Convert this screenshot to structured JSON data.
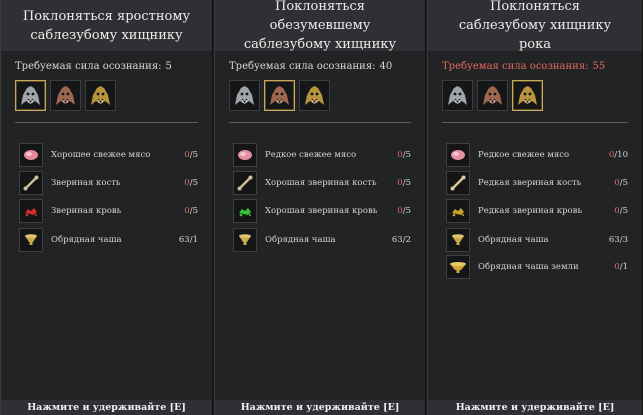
{
  "panels": [
    {
      "title": "Поклоняться яростному саблезубому хищнику",
      "requirement_label": "Требуемая сила осознания:",
      "requirement_value": "5",
      "requirement_warning": false,
      "selected_beast": 0,
      "beasts": [
        "silver-beast-icon",
        "bronze-beast-icon",
        "gold-beast-icon"
      ],
      "materials": [
        {
          "name": "Хорошее свежее мясо",
          "have": "0",
          "need": "5",
          "icon": "meat-icon",
          "color": "#e28b9b",
          "low": true
        },
        {
          "name": "Звериная кость",
          "have": "0",
          "need": "5",
          "icon": "bone-icon",
          "color": "#cdbf99",
          "low": true
        },
        {
          "name": "Звериная кровь",
          "have": "0",
          "need": "5",
          "icon": "blood-icon",
          "color": "#d02e2e",
          "low": true
        },
        {
          "name": "Обрядная чаша",
          "have": "63",
          "need": "1",
          "icon": "chalice-icon",
          "color": "#c9a94e",
          "low": false
        }
      ],
      "footer": "Нажмите и удерживайте [E]"
    },
    {
      "title": "Поклоняться обезумевшему саблезубому хищнику",
      "requirement_label": "Требуемая сила осознания:",
      "requirement_value": "40",
      "requirement_warning": false,
      "selected_beast": 1,
      "beasts": [
        "silver-beast-icon",
        "bronze-beast-icon",
        "gold-beast-icon"
      ],
      "materials": [
        {
          "name": "Редкое свежее мясо",
          "have": "0",
          "need": "5",
          "icon": "meat-icon",
          "color": "#e58fa0",
          "low": true
        },
        {
          "name": "Хорошая звериная кость",
          "have": "0",
          "need": "5",
          "icon": "bone-icon",
          "color": "#cdbf99",
          "low": true
        },
        {
          "name": "Хорошая звериная кровь",
          "have": "0",
          "need": "5",
          "icon": "blood-icon",
          "color": "#39c23a",
          "low": true
        },
        {
          "name": "Обрядная чаша",
          "have": "63",
          "need": "2",
          "icon": "chalice-icon",
          "color": "#c9a94e",
          "low": false
        }
      ],
      "footer": "Нажмите и удерживайте [E]"
    },
    {
      "title": "Поклоняться саблезубому хищнику рока",
      "requirement_label": "Требуемая сила осознания:",
      "requirement_value": "55",
      "requirement_warning": true,
      "selected_beast": 2,
      "beasts": [
        "silver-beast-icon",
        "bronze-beast-icon",
        "gold-beast-icon"
      ],
      "materials": [
        {
          "name": "Редкое свежее мясо",
          "have": "0",
          "need": "10",
          "icon": "meat-icon",
          "color": "#e58fa0",
          "low": true
        },
        {
          "name": "Редкая звериная кость",
          "have": "0",
          "need": "5",
          "icon": "bone-icon",
          "color": "#d9c89a",
          "low": true
        },
        {
          "name": "Редкая звериная кровь",
          "have": "0",
          "need": "5",
          "icon": "blood-icon",
          "color": "#c8a52e",
          "low": true
        },
        {
          "name": "Обрядная чаша",
          "have": "63",
          "need": "3",
          "icon": "chalice-icon",
          "color": "#c9a94e",
          "low": false
        },
        {
          "name": "Обрядная чаша земли",
          "have": "0",
          "need": "1",
          "icon": "earth-chalice-icon",
          "color": "#d4a53a",
          "low": true
        }
      ],
      "footer": "Нажмите и удерживайте [E]"
    }
  ],
  "colors": {
    "warning": "#e2695c",
    "selected_border": "#c9a95f",
    "silver": "#b9bdc4",
    "bronze": "#b8765a",
    "gold": "#d6aa45"
  }
}
